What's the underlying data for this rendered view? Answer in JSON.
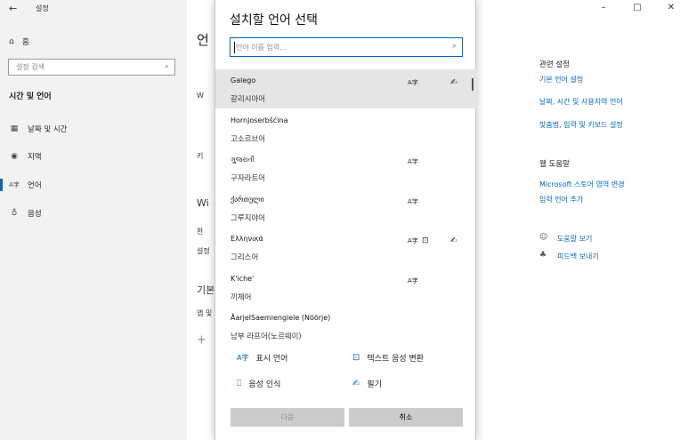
{
  "window": {
    "back_glyph": "←",
    "title": "설정",
    "controls": [
      "–",
      "□",
      "✕"
    ]
  },
  "sidebar": {
    "home_icon": "home-icon",
    "home_glyph": "⌂",
    "home_label": "홈",
    "search_placeholder": "설정 검색",
    "search_glyph": "⌕",
    "section_title": "시간 및 언어",
    "items": [
      {
        "glyph": "▦",
        "label": "날짜 및 시간"
      },
      {
        "glyph": "◉",
        "label": "지역"
      },
      {
        "glyph": "A字",
        "label": "언어"
      },
      {
        "glyph": "♁",
        "label": "음성"
      }
    ]
  },
  "content_peek": {
    "heading": "언",
    "wi_text": "Wi",
    "w_text": "W",
    "ki_text": "키",
    "ji_text": "한",
    "ga_text": "설정",
    "gi_text": "기본",
    "ap_text": "앱 및",
    "plus": "+"
  },
  "related": {
    "heading": "관련 설정",
    "links": [
      "기본 언어 설정",
      "날짜, 시간 및 사용지역 언어",
      "맞춤법, 입력 및 키보드 설정"
    ],
    "help_heading": "웹 도움말",
    "help_links": [
      "Microsoft 스토어 영역 변경",
      "입력 언어 추가"
    ],
    "feedback": [
      {
        "glyph": "☺",
        "label": "도움말 보기"
      },
      {
        "glyph": "♣",
        "label": "피드백 보내기"
      }
    ]
  },
  "dialog": {
    "title": "설치할 언어 선택",
    "search_placeholder": "언어 이름 입력...",
    "search_glyph": "⌕",
    "languages": [
      {
        "native": "Galego",
        "korean": "갈리시아어",
        "display": true,
        "speech": false,
        "handwriting": true,
        "selected": true
      },
      {
        "native": "Hornjoserbšćina",
        "korean": "고소르브어",
        "display": false,
        "speech": false,
        "handwriting": false,
        "selected": false
      },
      {
        "native": "ગુજરાતી",
        "korean": "구자라트어",
        "display": true,
        "speech": false,
        "handwriting": false,
        "selected": false
      },
      {
        "native": "ქართული",
        "korean": "그루지야어",
        "display": true,
        "speech": false,
        "handwriting": false,
        "selected": false
      },
      {
        "native": "Ελληνικά",
        "korean": "그리스어",
        "display": true,
        "speech": true,
        "handwriting": true,
        "selected": false
      },
      {
        "native": "K'iche'",
        "korean": "끼체어",
        "display": true,
        "speech": false,
        "handwriting": false,
        "selected": false
      },
      {
        "native": "ÅarjelSaemiengiele (Nöörje)",
        "korean": "남부 라프어(노르웨이)",
        "display": false,
        "speech": false,
        "handwriting": false,
        "selected": false
      }
    ],
    "feature_glyphs": {
      "display": "A字",
      "speech": "⊡",
      "handwriting": "✍"
    },
    "legend": [
      {
        "icon": "display-language-icon",
        "glyph": "A字",
        "label": "표시 언어"
      },
      {
        "icon": "text-to-speech-icon",
        "glyph": "⊡",
        "label": "텍스트 음성 변환"
      },
      {
        "icon": "speech-recognition-icon",
        "glyph": "🎙",
        "label": "음성 인식"
      },
      {
        "icon": "handwriting-icon",
        "glyph": "✍",
        "label": "필기"
      }
    ],
    "next_label": "다음",
    "cancel_label": "취소"
  },
  "colors": {
    "accent": "#0067c0",
    "selected_row": "#e5e5e5",
    "sidebar_bg": "#f2f2f2",
    "button_bg": "#cccccc"
  }
}
